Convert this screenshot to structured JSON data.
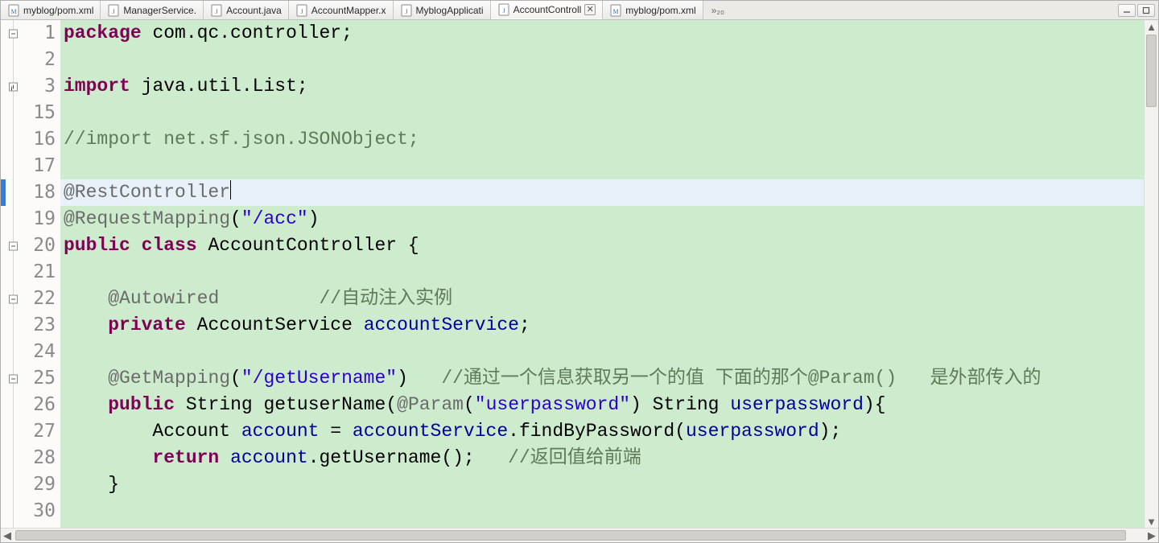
{
  "tabs": [
    {
      "label": "myblog/pom.xml",
      "icon": "xml",
      "active": false
    },
    {
      "label": "ManagerService.",
      "icon": "java",
      "active": false
    },
    {
      "label": "Account.java",
      "icon": "java",
      "active": false
    },
    {
      "label": "AccountMapper.x",
      "icon": "java",
      "active": false
    },
    {
      "label": "MyblogApplicati",
      "icon": "java",
      "active": false
    },
    {
      "label": "AccountControll",
      "icon": "java",
      "active": true
    },
    {
      "label": "myblog/pom.xml",
      "icon": "xml",
      "active": false
    }
  ],
  "overflow_glyph": "»₂₀",
  "code": {
    "lines": [
      {
        "n": 1,
        "fold": "minus",
        "tokens": [
          [
            "k",
            "package"
          ],
          [
            "pl",
            " "
          ],
          [
            "pkg",
            "com.qc.controller"
          ],
          [
            "pl",
            ";"
          ]
        ]
      },
      {
        "n": 2,
        "tokens": []
      },
      {
        "n": 3,
        "fold": "plus",
        "tokens": [
          [
            "k",
            "import"
          ],
          [
            "pl",
            " "
          ],
          [
            "pkg",
            "java.util.List"
          ],
          [
            "pl",
            ";"
          ]
        ]
      },
      {
        "n": 15,
        "tokens": []
      },
      {
        "n": 16,
        "tokens": [
          [
            "cm",
            "//import net.sf.json.JSONObject;"
          ]
        ]
      },
      {
        "n": 17,
        "tokens": []
      },
      {
        "n": 18,
        "hl": true,
        "caret": true,
        "tokens": [
          [
            "an",
            "@RestController"
          ]
        ]
      },
      {
        "n": 19,
        "tokens": [
          [
            "an",
            "@RequestMapping"
          ],
          [
            "pl",
            "("
          ],
          [
            "s",
            "\"/acc\""
          ],
          [
            "pl",
            ")"
          ]
        ]
      },
      {
        "n": 20,
        "fold": "minus",
        "tokens": [
          [
            "k",
            "public"
          ],
          [
            "pl",
            " "
          ],
          [
            "k",
            "class"
          ],
          [
            "pl",
            " "
          ],
          [
            "m",
            "AccountController"
          ],
          [
            "pl",
            " {"
          ]
        ]
      },
      {
        "n": 21,
        "tokens": []
      },
      {
        "n": 22,
        "fold": "minus",
        "tokens": [
          [
            "pl",
            "    "
          ],
          [
            "an",
            "@Autowired"
          ],
          [
            "pl",
            "         "
          ],
          [
            "cm",
            "//自动注入实例"
          ]
        ]
      },
      {
        "n": 23,
        "tokens": [
          [
            "pl",
            "    "
          ],
          [
            "k",
            "private"
          ],
          [
            "pl",
            " "
          ],
          [
            "m",
            "AccountService"
          ],
          [
            "pl",
            " "
          ],
          [
            "id",
            "accountService"
          ],
          [
            "pl",
            ";"
          ]
        ]
      },
      {
        "n": 24,
        "tokens": []
      },
      {
        "n": 25,
        "fold": "minus",
        "tokens": [
          [
            "pl",
            "    "
          ],
          [
            "an",
            "@GetMapping"
          ],
          [
            "pl",
            "("
          ],
          [
            "s",
            "\"/getUsername\""
          ],
          [
            "pl",
            ")   "
          ],
          [
            "cm",
            "//通过一个信息获取另一个的值 下面的那个@Param()   是外部传入的"
          ]
        ]
      },
      {
        "n": 26,
        "tokens": [
          [
            "pl",
            "    "
          ],
          [
            "k",
            "public"
          ],
          [
            "pl",
            " "
          ],
          [
            "m",
            "String"
          ],
          [
            "pl",
            " "
          ],
          [
            "m",
            "getuserName"
          ],
          [
            "pl",
            "("
          ],
          [
            "an",
            "@Param"
          ],
          [
            "pl",
            "("
          ],
          [
            "s",
            "\"userpassword\""
          ],
          [
            "pl",
            ") "
          ],
          [
            "m",
            "String"
          ],
          [
            "pl",
            " "
          ],
          [
            "id",
            "userpassword"
          ],
          [
            "pl",
            "){"
          ]
        ]
      },
      {
        "n": 27,
        "tokens": [
          [
            "pl",
            "        "
          ],
          [
            "m",
            "Account"
          ],
          [
            "pl",
            " "
          ],
          [
            "id",
            "account"
          ],
          [
            "pl",
            " = "
          ],
          [
            "id",
            "accountService"
          ],
          [
            "pl",
            "."
          ],
          [
            "m",
            "findByPassword"
          ],
          [
            "pl",
            "("
          ],
          [
            "id",
            "userpassword"
          ],
          [
            "pl",
            ");"
          ]
        ]
      },
      {
        "n": 28,
        "tokens": [
          [
            "pl",
            "        "
          ],
          [
            "k",
            "return"
          ],
          [
            "pl",
            " "
          ],
          [
            "id",
            "account"
          ],
          [
            "pl",
            "."
          ],
          [
            "m",
            "getUsername"
          ],
          [
            "pl",
            "();   "
          ],
          [
            "cm",
            "//返回值给前端"
          ]
        ]
      },
      {
        "n": 29,
        "tokens": [
          [
            "pl",
            "    }"
          ]
        ]
      },
      {
        "n": 30,
        "tokens": []
      }
    ]
  }
}
